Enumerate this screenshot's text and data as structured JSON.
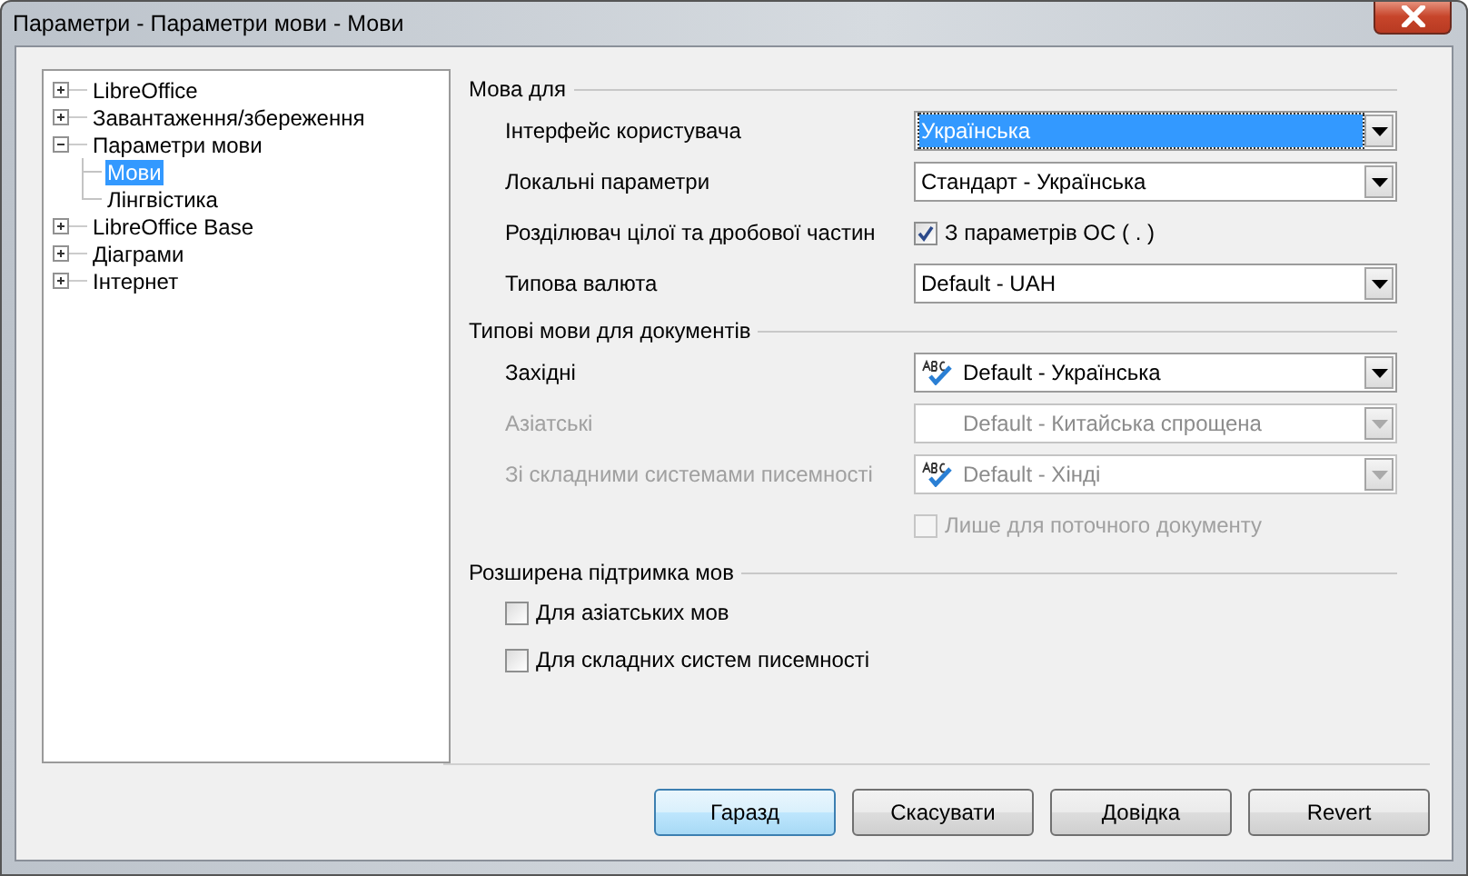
{
  "window": {
    "title": "Параметри - Параметри мови - Мови"
  },
  "tree": [
    {
      "label": "LibreOffice",
      "expanded": false,
      "selected": false
    },
    {
      "label": "Завантаження/збереження",
      "expanded": false,
      "selected": false
    },
    {
      "label": "Параметри мови",
      "expanded": true,
      "selected": false,
      "children": [
        {
          "label": "Мови",
          "selected": true
        },
        {
          "label": "Лінгвістика",
          "selected": false
        }
      ]
    },
    {
      "label": "LibreOffice Base",
      "expanded": false,
      "selected": false
    },
    {
      "label": "Діаграми",
      "expanded": false,
      "selected": false
    },
    {
      "label": "Інтернет",
      "expanded": false,
      "selected": false
    }
  ],
  "sections": [
    {
      "title": "Мова для",
      "rows": [
        {
          "kind": "dropdown",
          "label": "Інтерфейс користувача",
          "value": "Українська",
          "selected": true,
          "spellcheck": false,
          "disabled": false
        },
        {
          "kind": "dropdown",
          "label": "Локальні параметри",
          "value": "Стандарт - Українська",
          "selected": false,
          "spellcheck": false,
          "disabled": false
        },
        {
          "kind": "checkbox",
          "label": "Розділювач цілої та дробової частин",
          "text": "З параметрів ОС ( . )",
          "checked": true,
          "disabled": false
        },
        {
          "kind": "dropdown",
          "label": "Типова валюта",
          "value": "Default - UAH",
          "selected": false,
          "spellcheck": false,
          "disabled": false
        }
      ]
    },
    {
      "title": "Типові мови для документів",
      "rows": [
        {
          "kind": "dropdown",
          "label": "Західні",
          "value": "Default - Українська",
          "selected": false,
          "spellcheck": true,
          "disabled": false
        },
        {
          "kind": "dropdown",
          "label": "Азіатські",
          "value": "Default - Китайська спрощена",
          "selected": false,
          "spellcheck": false,
          "disabled": true
        },
        {
          "kind": "dropdown",
          "label": "Зі складними системами писемності",
          "value": "Default - Хінді",
          "selected": false,
          "spellcheck": true,
          "disabled": true
        },
        {
          "kind": "checkbox",
          "text": "Лише для поточного документу",
          "checked": false,
          "disabled": true
        }
      ]
    },
    {
      "title": "Розширена підтримка мов",
      "rows": [
        {
          "kind": "option",
          "text": "Для азіатських мов",
          "checked": false,
          "disabled": false
        },
        {
          "kind": "option",
          "text": "Для складних систем писемності",
          "checked": false,
          "disabled": false
        }
      ]
    }
  ],
  "buttons": [
    {
      "label": "Гаразд",
      "focused": true
    },
    {
      "label": "Скасувати",
      "focused": false
    },
    {
      "label": "Довідка",
      "focused": false
    },
    {
      "label": "Revert",
      "focused": false
    }
  ]
}
